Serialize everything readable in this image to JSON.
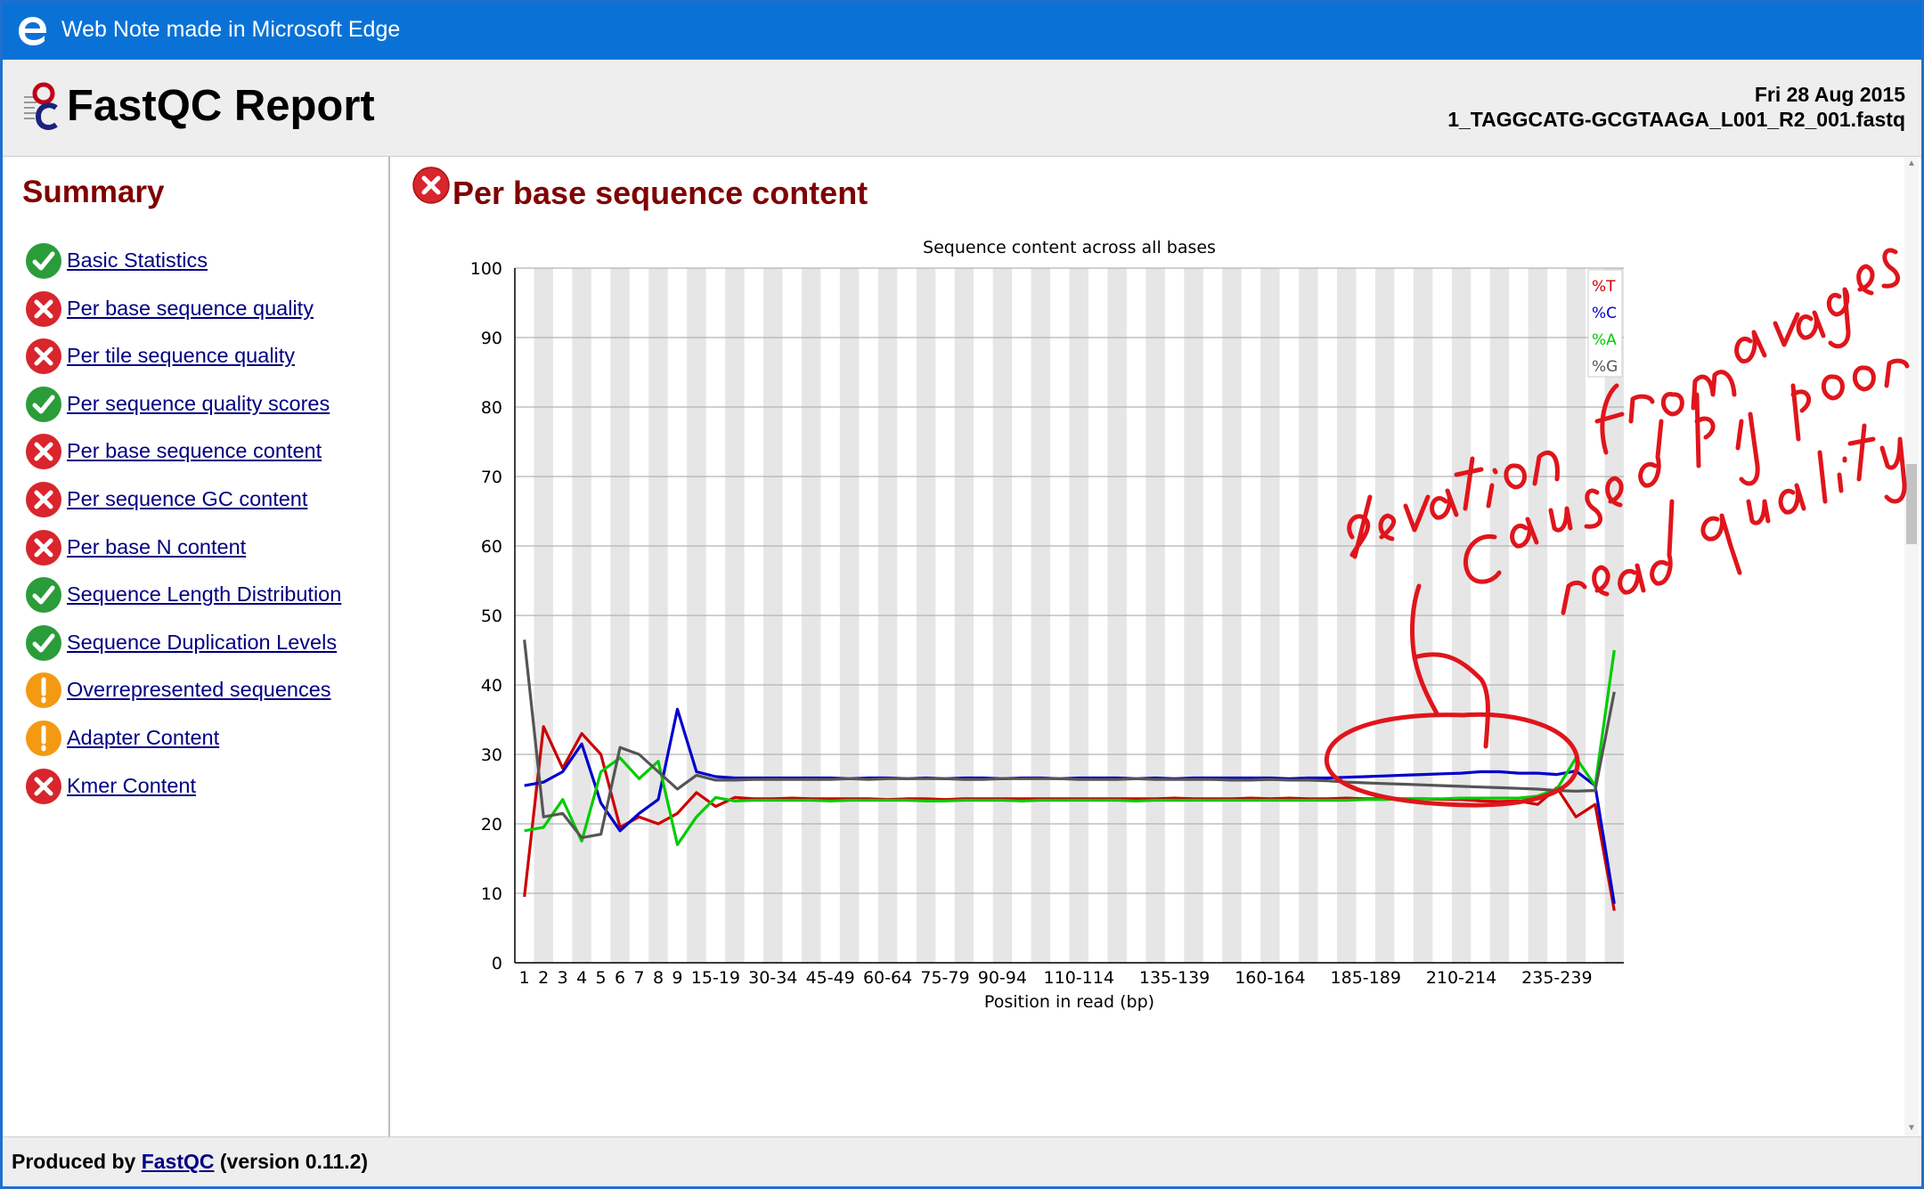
{
  "titlebar": {
    "title": "Web Note made in Microsoft Edge"
  },
  "header": {
    "title": "FastQC Report",
    "date": "Fri 28 Aug 2015",
    "filename": "1_TAGGCATG-GCGTAAGA_L001_R2_001.fastq"
  },
  "sidebar": {
    "title": "Summary",
    "items": [
      {
        "label": "Basic Statistics",
        "status": "pass"
      },
      {
        "label": "Per base sequence quality",
        "status": "fail"
      },
      {
        "label": "Per tile sequence quality",
        "status": "fail"
      },
      {
        "label": "Per sequence quality scores",
        "status": "pass"
      },
      {
        "label": "Per base sequence content",
        "status": "fail"
      },
      {
        "label": "Per sequence GC content",
        "status": "fail"
      },
      {
        "label": "Per base N content",
        "status": "fail"
      },
      {
        "label": "Sequence Length Distribution",
        "status": "pass"
      },
      {
        "label": "Sequence Duplication Levels",
        "status": "pass"
      },
      {
        "label": "Overrepresented sequences",
        "status": "warn"
      },
      {
        "label": "Adapter Content",
        "status": "warn"
      },
      {
        "label": "Kmer Content",
        "status": "fail"
      }
    ]
  },
  "section": {
    "title": "Per base sequence content",
    "status": "fail"
  },
  "annotation": {
    "text": "deviation from averages caused by poor read quality",
    "color": "#e0151c"
  },
  "colors": {
    "pass": "#2a9d3a",
    "fail": "#d9252c",
    "warn": "#f39a12",
    "heading": "#800000",
    "link": "#000080",
    "titlebar": "#0a72d6"
  },
  "chart_data": {
    "type": "line",
    "title": "Sequence content across all bases",
    "xlabel": "Position in read (bp)",
    "ylabel": "",
    "ylim": [
      0,
      100
    ],
    "yticks": [
      0,
      10,
      20,
      30,
      40,
      50,
      60,
      70,
      80,
      90,
      100
    ],
    "categories": [
      "1",
      "2",
      "3",
      "4",
      "5",
      "6",
      "7",
      "8",
      "9",
      "10-14",
      "15-19",
      "20-24",
      "25-29",
      "30-34",
      "35-39",
      "40-44",
      "45-49",
      "50-54",
      "55-59",
      "60-64",
      "65-69",
      "70-74",
      "75-79",
      "80-84",
      "85-89",
      "90-94",
      "95-99",
      "100-104",
      "105-109",
      "110-114",
      "115-119",
      "120-124",
      "125-129",
      "130-134",
      "135-139",
      "140-144",
      "145-149",
      "150-154",
      "155-159",
      "160-164",
      "165-169",
      "170-174",
      "175-179",
      "180-184",
      "185-189",
      "190-194",
      "195-199",
      "200-204",
      "205-209",
      "210-214",
      "215-219",
      "220-224",
      "225-229",
      "230-234",
      "235-239",
      "240-244",
      "245-249",
      "250-251"
    ],
    "xtick_labels": [
      "1",
      "2",
      "3",
      "4",
      "5",
      "6",
      "7",
      "8",
      "9",
      "15-19",
      "30-34",
      "45-49",
      "60-64",
      "75-79",
      "90-94",
      "110-114",
      "135-139",
      "160-164",
      "185-189",
      "210-214",
      "235-239"
    ],
    "legend": [
      "%T",
      "%C",
      "%A",
      "%G"
    ],
    "legend_position": "top-right",
    "grid": true,
    "series": [
      {
        "name": "%T",
        "color": "#cc0000",
        "values": [
          9.5,
          34,
          28,
          33,
          30,
          19.5,
          21,
          20,
          21.5,
          24.5,
          22.5,
          23.8,
          23.6,
          23.6,
          23.7,
          23.6,
          23.6,
          23.6,
          23.6,
          23.5,
          23.6,
          23.6,
          23.5,
          23.6,
          23.6,
          23.6,
          23.6,
          23.6,
          23.6,
          23.6,
          23.6,
          23.6,
          23.6,
          23.6,
          23.7,
          23.6,
          23.6,
          23.6,
          23.7,
          23.6,
          23.7,
          23.6,
          23.6,
          23.7,
          23.6,
          23.6,
          23.6,
          23.6,
          23.5,
          23.5,
          23.3,
          23.2,
          23.3,
          22.8,
          25.2,
          21,
          22.8,
          7.5
        ]
      },
      {
        "name": "%C",
        "color": "#0000cc",
        "values": [
          25.5,
          26,
          27.5,
          31.5,
          23,
          19,
          21.5,
          23.5,
          36.5,
          27.5,
          26.8,
          26.6,
          26.6,
          26.6,
          26.6,
          26.6,
          26.6,
          26.5,
          26.6,
          26.6,
          26.5,
          26.6,
          26.5,
          26.6,
          26.6,
          26.5,
          26.6,
          26.6,
          26.5,
          26.6,
          26.6,
          26.6,
          26.5,
          26.6,
          26.5,
          26.6,
          26.6,
          26.6,
          26.6,
          26.6,
          26.5,
          26.6,
          26.6,
          26.7,
          26.8,
          26.9,
          27,
          27.1,
          27.2,
          27.3,
          27.5,
          27.5,
          27.3,
          27.3,
          27.1,
          27.6,
          25.5,
          8.5
        ]
      },
      {
        "name": "%A",
        "color": "#00cc00",
        "values": [
          19,
          19.5,
          23.5,
          17.5,
          27.5,
          29.5,
          26.5,
          29,
          17,
          21,
          23.8,
          23.3,
          23.4,
          23.4,
          23.4,
          23.4,
          23.3,
          23.4,
          23.4,
          23.4,
          23.4,
          23.3,
          23.3,
          23.4,
          23.4,
          23.4,
          23.3,
          23.4,
          23.4,
          23.4,
          23.4,
          23.4,
          23.3,
          23.4,
          23.4,
          23.4,
          23.4,
          23.4,
          23.4,
          23.4,
          23.4,
          23.4,
          23.4,
          23.4,
          23.5,
          23.5,
          23.6,
          23.6,
          23.6,
          23.7,
          23.7,
          23.7,
          23.7,
          24,
          25,
          29.5,
          25.5,
          45
        ]
      },
      {
        "name": "%G",
        "color": "#555555",
        "values": [
          46.5,
          21,
          21.5,
          18,
          18.5,
          31,
          30,
          27.5,
          25,
          27,
          26.3,
          26.3,
          26.4,
          26.4,
          26.4,
          26.4,
          26.4,
          26.5,
          26.4,
          26.5,
          26.5,
          26.5,
          26.5,
          26.4,
          26.4,
          26.5,
          26.5,
          26.5,
          26.5,
          26.4,
          26.4,
          26.4,
          26.5,
          26.4,
          26.4,
          26.4,
          26.4,
          26.3,
          26.3,
          26.4,
          26.3,
          26.3,
          26.2,
          26,
          25.9,
          25.8,
          25.7,
          25.6,
          25.5,
          25.4,
          25.3,
          25.2,
          25.1,
          25,
          24.8,
          24.7,
          24.8,
          39
        ]
      }
    ]
  },
  "footer": {
    "prefix": "Produced by",
    "link": "FastQC",
    "suffix": "(version 0.11.2)"
  }
}
